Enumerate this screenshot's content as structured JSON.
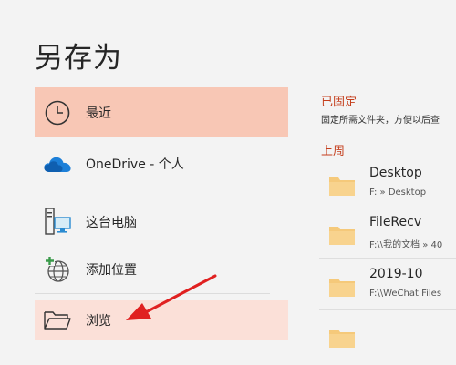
{
  "page": {
    "title": "另存为"
  },
  "nav": {
    "items": [
      {
        "label": "最近",
        "icon": "clock-icon"
      },
      {
        "label": "OneDrive - 个人",
        "icon": "onedrive-cloud-icon"
      },
      {
        "label": "这台电脑",
        "icon": "computer-icon"
      },
      {
        "label": "添加位置",
        "icon": "add-location-globe-icon"
      },
      {
        "label": "浏览",
        "icon": "folder-open-icon"
      }
    ]
  },
  "pinned": {
    "heading": "已固定",
    "description": "固定所需文件夹，方便以后查"
  },
  "last_week": {
    "heading": "上周",
    "folders": [
      {
        "name": "Desktop",
        "path": "F: » Desktop"
      },
      {
        "name": "FileRecv",
        "path": "F:\\\\我的文档 » 40"
      },
      {
        "name": "2019-10",
        "path": "F:\\\\WeChat Files"
      }
    ]
  },
  "colors": {
    "accent": "#c43e1c",
    "selected_bg": "#f8c7b5",
    "hover_bg": "#fbe0d8",
    "folder": "#f5c97a",
    "arrow": "#e02020"
  }
}
